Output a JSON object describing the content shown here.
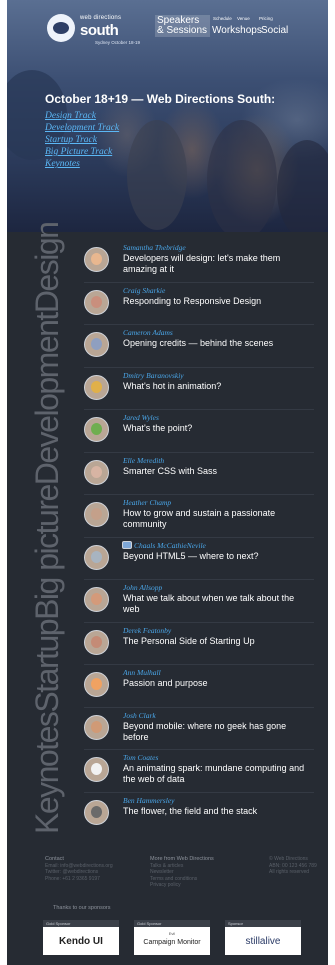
{
  "brand": {
    "logo_small": "web directions",
    "logo_big": "south",
    "date": "Sydney October 18-19",
    "accent": "#4aa6e8",
    "background": "#262b33"
  },
  "nav": {
    "speakers": "Speakers & Sessions",
    "schedule": "Schedule",
    "venue": "Venue",
    "pricing": "Pricing",
    "workshops": "Workshops",
    "social": "Social"
  },
  "hero": {
    "title": "October 18+19 — Web Directions South:",
    "tracks": [
      "Design Track",
      "Development Track",
      "Startup Track",
      "Big Picture Track",
      "Keynotes"
    ]
  },
  "side_title": "KeynotesStartupBig pictureDevelopmentDesign",
  "talks": [
    {
      "speaker": "Samantha Thebridge",
      "title": "Developers will design: let's make them amazing at it",
      "face": "#e8b78f"
    },
    {
      "speaker": "Craig Sharkie",
      "title": "Responding to Responsive Design",
      "face": "#c98f7d"
    },
    {
      "speaker": "Cameron Adams",
      "title": "Opening credits — behind the scenes",
      "face": "#8f9fc0"
    },
    {
      "speaker": "Dmitry Baranovskiy",
      "title": "What's hot in animation?",
      "face": "#e0b04a"
    },
    {
      "speaker": "Jared Wyles",
      "title": "What's the point?",
      "face": "#6fae4f"
    },
    {
      "speaker": "Elle Meredith",
      "title": "Smarter CSS with Sass",
      "face": "#d7b4a3"
    },
    {
      "speaker": "Heather Champ",
      "title": "How to grow and sustain a passionate community",
      "face": "#c4a08a"
    },
    {
      "speaker": "Chaals McCathieNevile",
      "title": "Beyond HTML5 — where to next?",
      "face": "#a8b4c0"
    },
    {
      "speaker": "John Allsopp",
      "title": "What we talk about when we talk about the web",
      "face": "#d49a7a"
    },
    {
      "speaker": "Derek Featonby",
      "title": "The Personal Side of Starting Up",
      "face": "#c48b76"
    },
    {
      "speaker": "Ann Mulhall",
      "title": "Passion and purpose",
      "face": "#f0a262"
    },
    {
      "speaker": "Josh Clark",
      "title": "Beyond mobile: where no geek has gone before",
      "face": "#d09a76"
    },
    {
      "speaker": "Tom Coates",
      "title": "An animating spark: mundane computing and the web of data",
      "face": "#f2f2f2"
    },
    {
      "speaker": "Ben Hammersley",
      "title": "The flower, the field and the stack",
      "face": "#6a6a6a"
    }
  ],
  "footer": {
    "contact_head": "Contact",
    "contact_lines": [
      "Email: info@webdirections.org",
      "Twitter: @webdirections",
      "Phone: +61 2 9365 9197"
    ],
    "more_head": "More from Web Directions",
    "more_lines": [
      "Talks & articles",
      "Newsletter",
      "Terms and conditions",
      "Privacy policy"
    ],
    "legal_lines": [
      "© Web Directions",
      "ABN: 00 123 456 789",
      "All rights reserved"
    ],
    "sponsors_label": "Thanks to our sponsors",
    "sponsors": [
      {
        "tier": "Gold Sponsor",
        "name": "Kendo UI",
        "sub": ""
      },
      {
        "tier": "Gold Sponsor",
        "name": "Campaign Monitor",
        "sub": "Evil"
      },
      {
        "tier": "Sponsor",
        "name": "stillalive",
        "sub": ""
      }
    ]
  }
}
